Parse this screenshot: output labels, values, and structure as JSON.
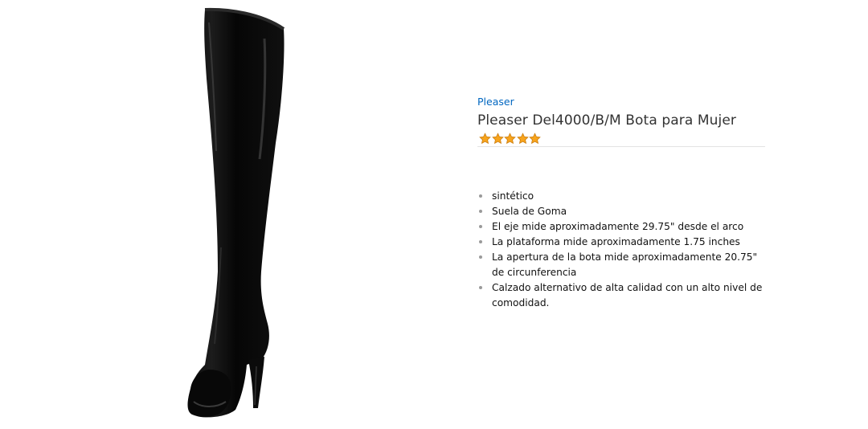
{
  "product": {
    "brand": "Pleaser",
    "title": "Pleaser Del4000/B/M Bota para Mujer",
    "rating_stars": 5,
    "rating_color": "#f7a41d",
    "image_icon": "black-thigh-high-boot-image"
  },
  "features": [
    "sintético",
    "Suela de Goma",
    "El eje mide aproximadamente 29.75\" desde el arco",
    "La plataforma mide aproximadamente 1.75 inches",
    "La apertura de la bota mide aproximadamente 20.75\" de circunferencia",
    "Calzado alternativo de alta calidad con un alto nivel de comodidad."
  ]
}
